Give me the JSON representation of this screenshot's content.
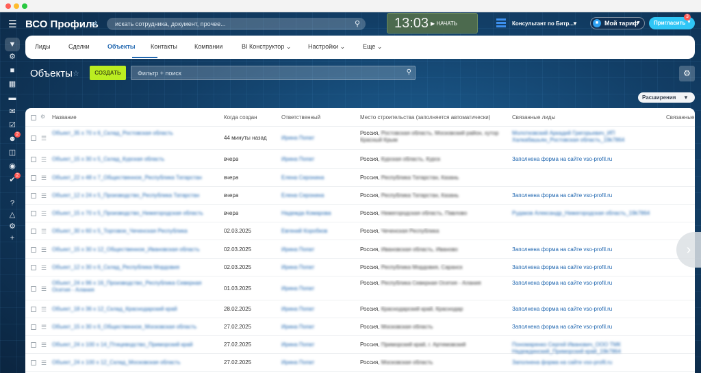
{
  "header": {
    "brand": "ВСО Профиль",
    "search_placeholder": "искать сотрудника, документ, прочее...",
    "clock_time": "13:03",
    "clock_start": "НАЧАТЬ",
    "portal_name": "Консультант по Битр...",
    "tariff_label": "Мой тариф",
    "invite_label": "Пригласить",
    "invite_badge": "3"
  },
  "rail": {
    "badge_1": "2",
    "badge_2": "2"
  },
  "tabs": [
    {
      "label": "Лиды"
    },
    {
      "label": "Сделки"
    },
    {
      "label": "Объекты"
    },
    {
      "label": "Контакты"
    },
    {
      "label": "Компании"
    },
    {
      "label": "BI Конструктор"
    },
    {
      "label": "Настройки"
    },
    {
      "label": "Еще"
    }
  ],
  "toolbar": {
    "title": "Объекты",
    "create": "СОЗДАТЬ",
    "filter_placeholder": "Фильтр + поиск",
    "extensions": "Расширения"
  },
  "columns": {
    "name": "Название",
    "created": "Когда создан",
    "responsible": "Ответственный",
    "place": "Место строительства (заполняется автоматически)",
    "leads": "Связанные лиды",
    "more": "Связанные"
  },
  "rows": [
    {
      "name": "Объект_35 x 70 x 6_Склад_Ростовская область",
      "created": "44 минуты назад",
      "resp": "Ирина Попат",
      "country": "Россия,",
      "region": "Ростовская область, Московский район, хутор Красный Крым",
      "lead": "Молотковский Аркадий Григорьевич_ИП Халкабашьян_Ростовская область_19k7864",
      "lead_blur": true
    },
    {
      "name": "Объект_15 x 30 x 5_Склад_Курская область",
      "created": "вчера",
      "resp": "Ирина Попат",
      "country": "Россия,",
      "region": "Курская область, Курск",
      "lead": "Заполнена форма на сайте vso-profil.ru",
      "lead_blur": false
    },
    {
      "name": "Объект_22 x 48 x 7_Общественное_Республика Татарстан",
      "created": "вчера",
      "resp": "Елена Серонина",
      "country": "Россия,",
      "region": "Республика Татарстан, Казань",
      "lead": "",
      "lead_blur": false
    },
    {
      "name": "Объект_12 x 24 x 5_Производство_Республика Татарстан",
      "created": "вчера",
      "resp": "Елена Серонина",
      "country": "Россия,",
      "region": "Республика Татарстан, Казань",
      "lead": "Заполнена форма на сайте vso-profil.ru",
      "lead_blur": false
    },
    {
      "name": "Объект_15 x 70 x 5_Производство_Нижегородская область",
      "created": "вчера",
      "resp": "Надежда Комарова",
      "country": "Россия,",
      "region": "Нижегородская область, Павлово",
      "lead": "Рудаков Александр_Нижегородская область_19k7864",
      "lead_blur": true
    },
    {
      "name": "Объект_30 x 60 x 5_Торговое_Чеченская Республика",
      "created": "02.03.2025",
      "resp": "Евгений Коробков",
      "country": "Россия,",
      "region": "Чеченская Республика",
      "lead": "",
      "lead_blur": false
    },
    {
      "name": "Объект_15 x 30 x 12_Общественное_Ивановская область",
      "created": "02.03.2025",
      "resp": "Ирина Попат",
      "country": "Россия,",
      "region": "Ивановская область, Иваново",
      "lead": "Заполнена форма на сайте vso-profil.ru",
      "lead_blur": false
    },
    {
      "name": "Объект_12 x 30 x 6_Склад_Республика Мордовия",
      "created": "02.03.2025",
      "resp": "Ирина Попат",
      "country": "Россия,",
      "region": "Республика Мордовия, Саранск",
      "lead": "Заполнена форма на сайте vso-profil.ru",
      "lead_blur": false
    },
    {
      "name": "Объект_24 x 96 x 16_Производство_Республика Северная Осетия - Алания",
      "created": "01.03.2025",
      "resp": "Ирина Попат",
      "country": "Россия,",
      "region": "Республика Северная Осетия - Алания",
      "lead": "Заполнена форма на сайте vso-profil.ru",
      "lead_blur": false
    },
    {
      "name": "Объект_18 x 36 x 12_Склад_Краснодарский край",
      "created": "28.02.2025",
      "resp": "Ирина Попат",
      "country": "Россия,",
      "region": "Краснодарский край, Краснодар",
      "lead": "Заполнена форма на сайте vso-profil.ru",
      "lead_blur": false
    },
    {
      "name": "Объект_15 x 30 x 6_Общественное_Московская область",
      "created": "27.02.2025",
      "resp": "Ирина Попат",
      "country": "Россия,",
      "region": "Московская область",
      "lead": "Заполнена форма на сайте vso-profil.ru",
      "lead_blur": false
    },
    {
      "name": "Объект_24 x 100 x 14_Птицеводство_Приморский край",
      "created": "27.02.2025",
      "resp": "Ирина Попат",
      "country": "Россия,",
      "region": "Приморский край, г. Артемовский",
      "lead": "Пономаренко Сергей Иванович_ООО ТМК Надеждинский_Приморский край_19k7864",
      "lead_blur": true
    },
    {
      "name": "Объект_24 x 100 x 12_Склад_Московская область",
      "created": "27.02.2025",
      "resp": "Ирина Попат",
      "country": "Россия,",
      "region": "Московская область",
      "lead": "Заполнена форма на сайте vso-profil.ru",
      "lead_blur": true
    }
  ]
}
